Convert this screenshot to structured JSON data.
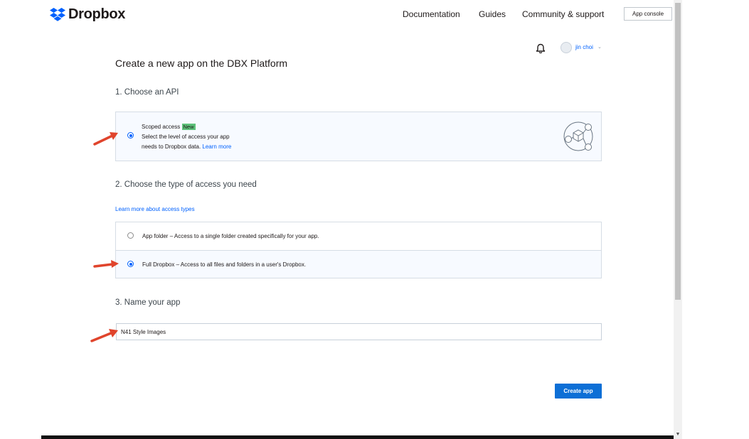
{
  "header": {
    "brand": "Dropbox",
    "nav": [
      "Documentation",
      "Guides",
      "Community & support"
    ],
    "app_console": "App console"
  },
  "user": {
    "name": "jin choi"
  },
  "page": {
    "title": "Create a new app on the DBX Platform"
  },
  "step1": {
    "heading": "1. Choose an API",
    "option_title": "Scoped access",
    "badge": "New",
    "desc_line1": "Select the level of access your app",
    "desc_line2": "needs to Dropbox data.",
    "learn_more": "Learn more"
  },
  "step2": {
    "heading": "2. Choose the type of access you need",
    "learn_link": "Learn more about access types",
    "options": [
      {
        "label": "App folder – Access to a single folder created specifically for your app.",
        "selected": false
      },
      {
        "label": "Full Dropbox – Access to all files and folders in a user's Dropbox.",
        "selected": true
      }
    ]
  },
  "step3": {
    "heading": "3. Name your app",
    "value": "N41 Style Images"
  },
  "create_button": "Create app",
  "colors": {
    "accent": "#0061fe",
    "annotation_arrow": "#e0442c",
    "badge": "#5ec27a"
  }
}
